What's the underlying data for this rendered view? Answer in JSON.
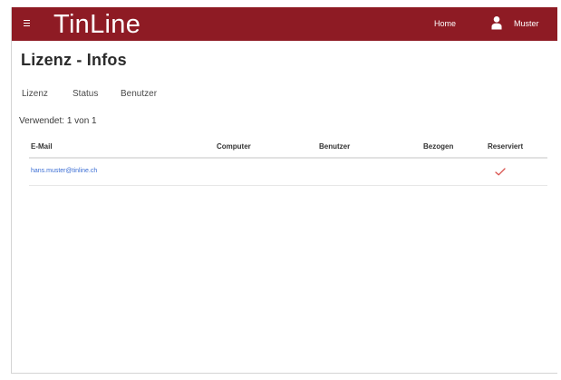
{
  "header": {
    "brand": "TinLine",
    "nav_home": "Home",
    "user_name": "Muster"
  },
  "page": {
    "title": "Lizenz - Infos",
    "tabs": [
      {
        "label": "Lizenz"
      },
      {
        "label": "Status"
      },
      {
        "label": "Benutzer"
      }
    ],
    "usage_text": "Verwendet: 1 von 1"
  },
  "table": {
    "columns": [
      "E-Mail",
      "Computer",
      "Benutzer",
      "Bezogen",
      "Reserviert"
    ],
    "rows": [
      {
        "email": "hans.muster@tinline.ch",
        "computer": "",
        "benutzer": "",
        "bezogen": "",
        "reserviert": true
      }
    ]
  },
  "colors": {
    "topbar": "#8e1b24",
    "link": "#3b6ed4",
    "check": "#d9534f"
  },
  "icons": {
    "menu": "menu-icon",
    "user": "user-icon",
    "reserved": "checkmark-icon"
  }
}
